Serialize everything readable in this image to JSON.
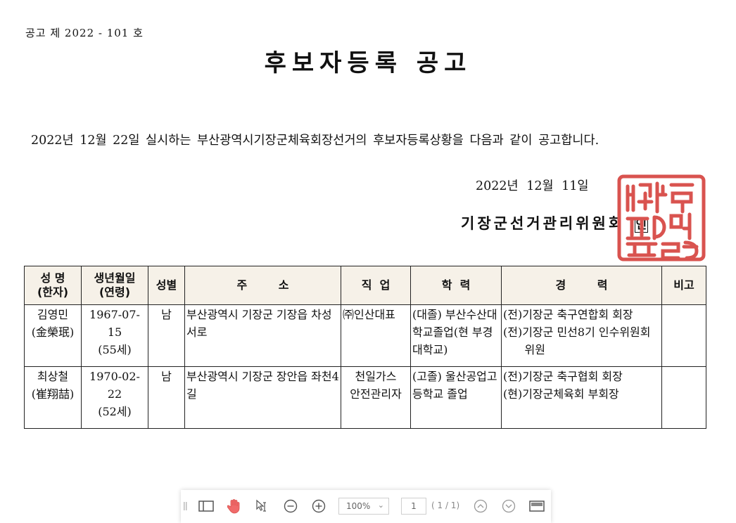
{
  "notice": {
    "number": "공고 제 2022 - 101  호",
    "title": "후보자등록 공고",
    "intro": "2022년  12월   22일 실시하는 부산광역시기장군체육회장선거의 후보자등록상황을 다음과 같이 공고합니다.",
    "date": "2022년  12월 11일",
    "committee": "기장군선거관리위원회",
    "seal_mark": "인"
  },
  "table": {
    "headers": [
      "성 명\n(한자)",
      "생년월일\n(연령)",
      "성별",
      "주        소",
      "직  업",
      "학  력",
      "경        력",
      "비고"
    ],
    "rows": [
      {
        "name": "김영민\n(金榮珉)",
        "birth": "1967-07-15\n(55세)",
        "gender": "남",
        "address": "부산광역시 기장군 기장읍 차성서로",
        "job": "㈜인산대표",
        "education": "(대졸) 부산수산대학교졸업(현 부경대학교)",
        "career": "(전)기장군 축구연합회 회장\n(전)기장군 민선8기 인수위원회\n      위원",
        "note": ""
      },
      {
        "name": "최상철\n(崔翔喆)",
        "birth": "1970-02-22\n(52세)",
        "gender": "남",
        "address": "부산광역시 기장군 장안읍 좌천4길",
        "job": "천일가스\n안전관리자",
        "education": "(고졸) 울산공업고등학교 졸업",
        "career": "(전)기장군 축구협회 회장\n(현)기장군체육회 부회장",
        "note": ""
      }
    ]
  },
  "toolbar": {
    "zoom": "100%",
    "page": "1",
    "page_count": "( 1 / 1)",
    "icons": [
      "sidebar-toggle-icon",
      "hand-tool-icon",
      "select-tool-icon",
      "zoom-out-icon",
      "zoom-in-icon",
      "previous-page-icon",
      "next-page-icon",
      "presentation-icon"
    ]
  },
  "colors": {
    "seal": "#d9534f",
    "header_bg": "#f6f1e8"
  }
}
